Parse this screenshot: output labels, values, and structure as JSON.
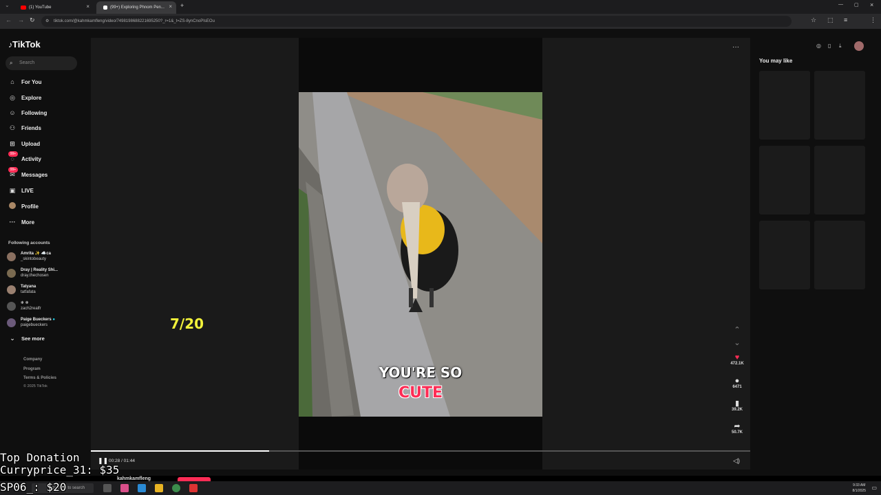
{
  "browser": {
    "tabs": [
      {
        "title": "(1) YouTube"
      },
      {
        "title": "(99+) Exploring Phnom Pen..."
      }
    ],
    "url": "tiktok.com/@kahmkamfleng/video/7498198688221695250?_r=1&_t=ZS-8ynCnoPIsEOu"
  },
  "tiktok": {
    "logo": "TikTok",
    "search_placeholder": "Search",
    "nav": [
      {
        "label": "For You",
        "icon": "home-icon"
      },
      {
        "label": "Explore",
        "icon": "compass-icon"
      },
      {
        "label": "Following",
        "icon": "following-icon"
      },
      {
        "label": "Friends",
        "icon": "friends-icon"
      },
      {
        "label": "Upload",
        "icon": "upload-icon"
      },
      {
        "label": "Activity",
        "icon": "activity-icon",
        "badge": "99+"
      },
      {
        "label": "Messages",
        "icon": "messages-icon",
        "badge": "99+"
      },
      {
        "label": "LIVE",
        "icon": "live-icon"
      },
      {
        "label": "Profile",
        "icon": "profile-icon"
      },
      {
        "label": "More",
        "icon": "more-icon"
      }
    ],
    "following_title": "Following accounts",
    "accounts": [
      {
        "name": "Amrita ✨ ☁️ca",
        "handle": "_skintobeauty"
      },
      {
        "name": "Dray | Reality Shi...",
        "handle": "dray.thechosen"
      },
      {
        "name": "Tatyana",
        "handle": "tatfafata"
      },
      {
        "name": "❄ ❄",
        "handle": "zach2realfr"
      },
      {
        "name": "Paige Bueckers",
        "handle": "paigebueckers"
      }
    ],
    "see_more": "See more",
    "footer": [
      "Company",
      "Program",
      "Terms & Policies",
      "© 2025 TikTok"
    ],
    "video": {
      "caption_line1": "YOU'RE SO",
      "caption_line2": "CUTE",
      "likes": "472.1K",
      "comments": "6471",
      "saves": "39.2K",
      "shares": "50.7K",
      "time": "00:28 / 01:44",
      "progress": 0.27,
      "author": "kahmkamfleng"
    },
    "you_may_like": "You may like"
  },
  "overlay": {
    "counter": "7/20",
    "top_donation_title": "Top Donation",
    "top_donation_line": "Curryprice_31: $35",
    "second_line": "SP06_: $20"
  },
  "taskbar": {
    "search_placeholder": "Type here to search",
    "time": "9:33 AM",
    "date": "8/1/2025"
  },
  "colors": {
    "accent": "#fe2c55",
    "counter": "#f2f23a"
  }
}
